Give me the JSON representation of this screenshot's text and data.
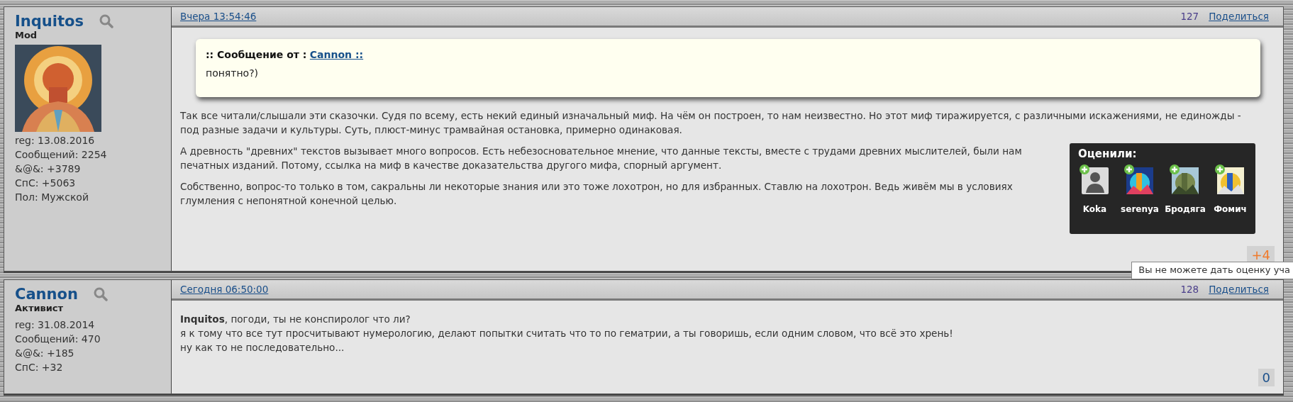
{
  "posts": [
    {
      "author": "Inquitos",
      "rank": "Mod",
      "avatar": {
        "kind": "picture"
      },
      "stats": [
        "reg: 13.08.2016",
        "Сообщений: 2254",
        "&@&: +3789",
        "СпС: +5063",
        "Пол: Мужской"
      ],
      "time": "Вчера 13:54:46",
      "number": "127",
      "share": "Поделиться",
      "quote": {
        "prefix": ":: Сообщение от :",
        "author": "Cannon ::",
        "text": "понятно?)"
      },
      "paragraphs": [
        [
          "Так все читали/слышали эти сказочки. Судя по всему, есть некий единый изначальный миф. На чём он построен, то нам неизвестно. Но этот миф тиражируется, с различными искажениями, не единожды -",
          "под разные задачи и культуры. Суть, плюст-минус трамвайная остановка, примерно одинаковая."
        ],
        [
          "А древность \"древних\" текстов вызывает много вопросов. Есть небезосновательное мнение, что данные тексты, вместе с трудами древних мыслителей, были нам",
          "печатных изданий. Потому, ссылка на миф в качестве доказательства другого мифа, спорный аргумент."
        ],
        [
          "Собственно, вопрос-то только в том, сакральны ли некоторые знания или это тоже лохотрон, но для избранных. Ставлю на лохотрон. Ведь живём мы в условиях",
          "глумления с непонятной конечной целью."
        ]
      ],
      "rating": {
        "value": "+4",
        "kind": "positive"
      },
      "raters": {
        "title": "Оценили:",
        "users": [
          {
            "name": "Koka",
            "kind": "silhouette"
          },
          {
            "name": "serenya",
            "kind": "picture"
          },
          {
            "name": "Бродяга",
            "kind": "picture"
          },
          {
            "name": "Фомич",
            "kind": "picture"
          }
        ]
      },
      "tooltip": "Вы не можете дать оценку уча"
    },
    {
      "author": "Cannon",
      "rank": "Активист",
      "stats": [
        "reg: 31.08.2014",
        "Сообщений: 470",
        "&@&: +185",
        "СпС: +32"
      ],
      "time": "Сегодня 06:50:00",
      "number": "128",
      "share": "Поделиться",
      "paragraphs": [
        [
          "**Inquitos**, погоди, ты не конспиролог что ли?",
          "я к тому что все тут просчитывают нумерологию, делают попытки считать что то по гематрии, а ты говоришь, если одним словом, что всё это хрень!",
          "ну как то не последовательно..."
        ]
      ],
      "rating": {
        "value": "0",
        "kind": "neutral"
      }
    }
  ]
}
